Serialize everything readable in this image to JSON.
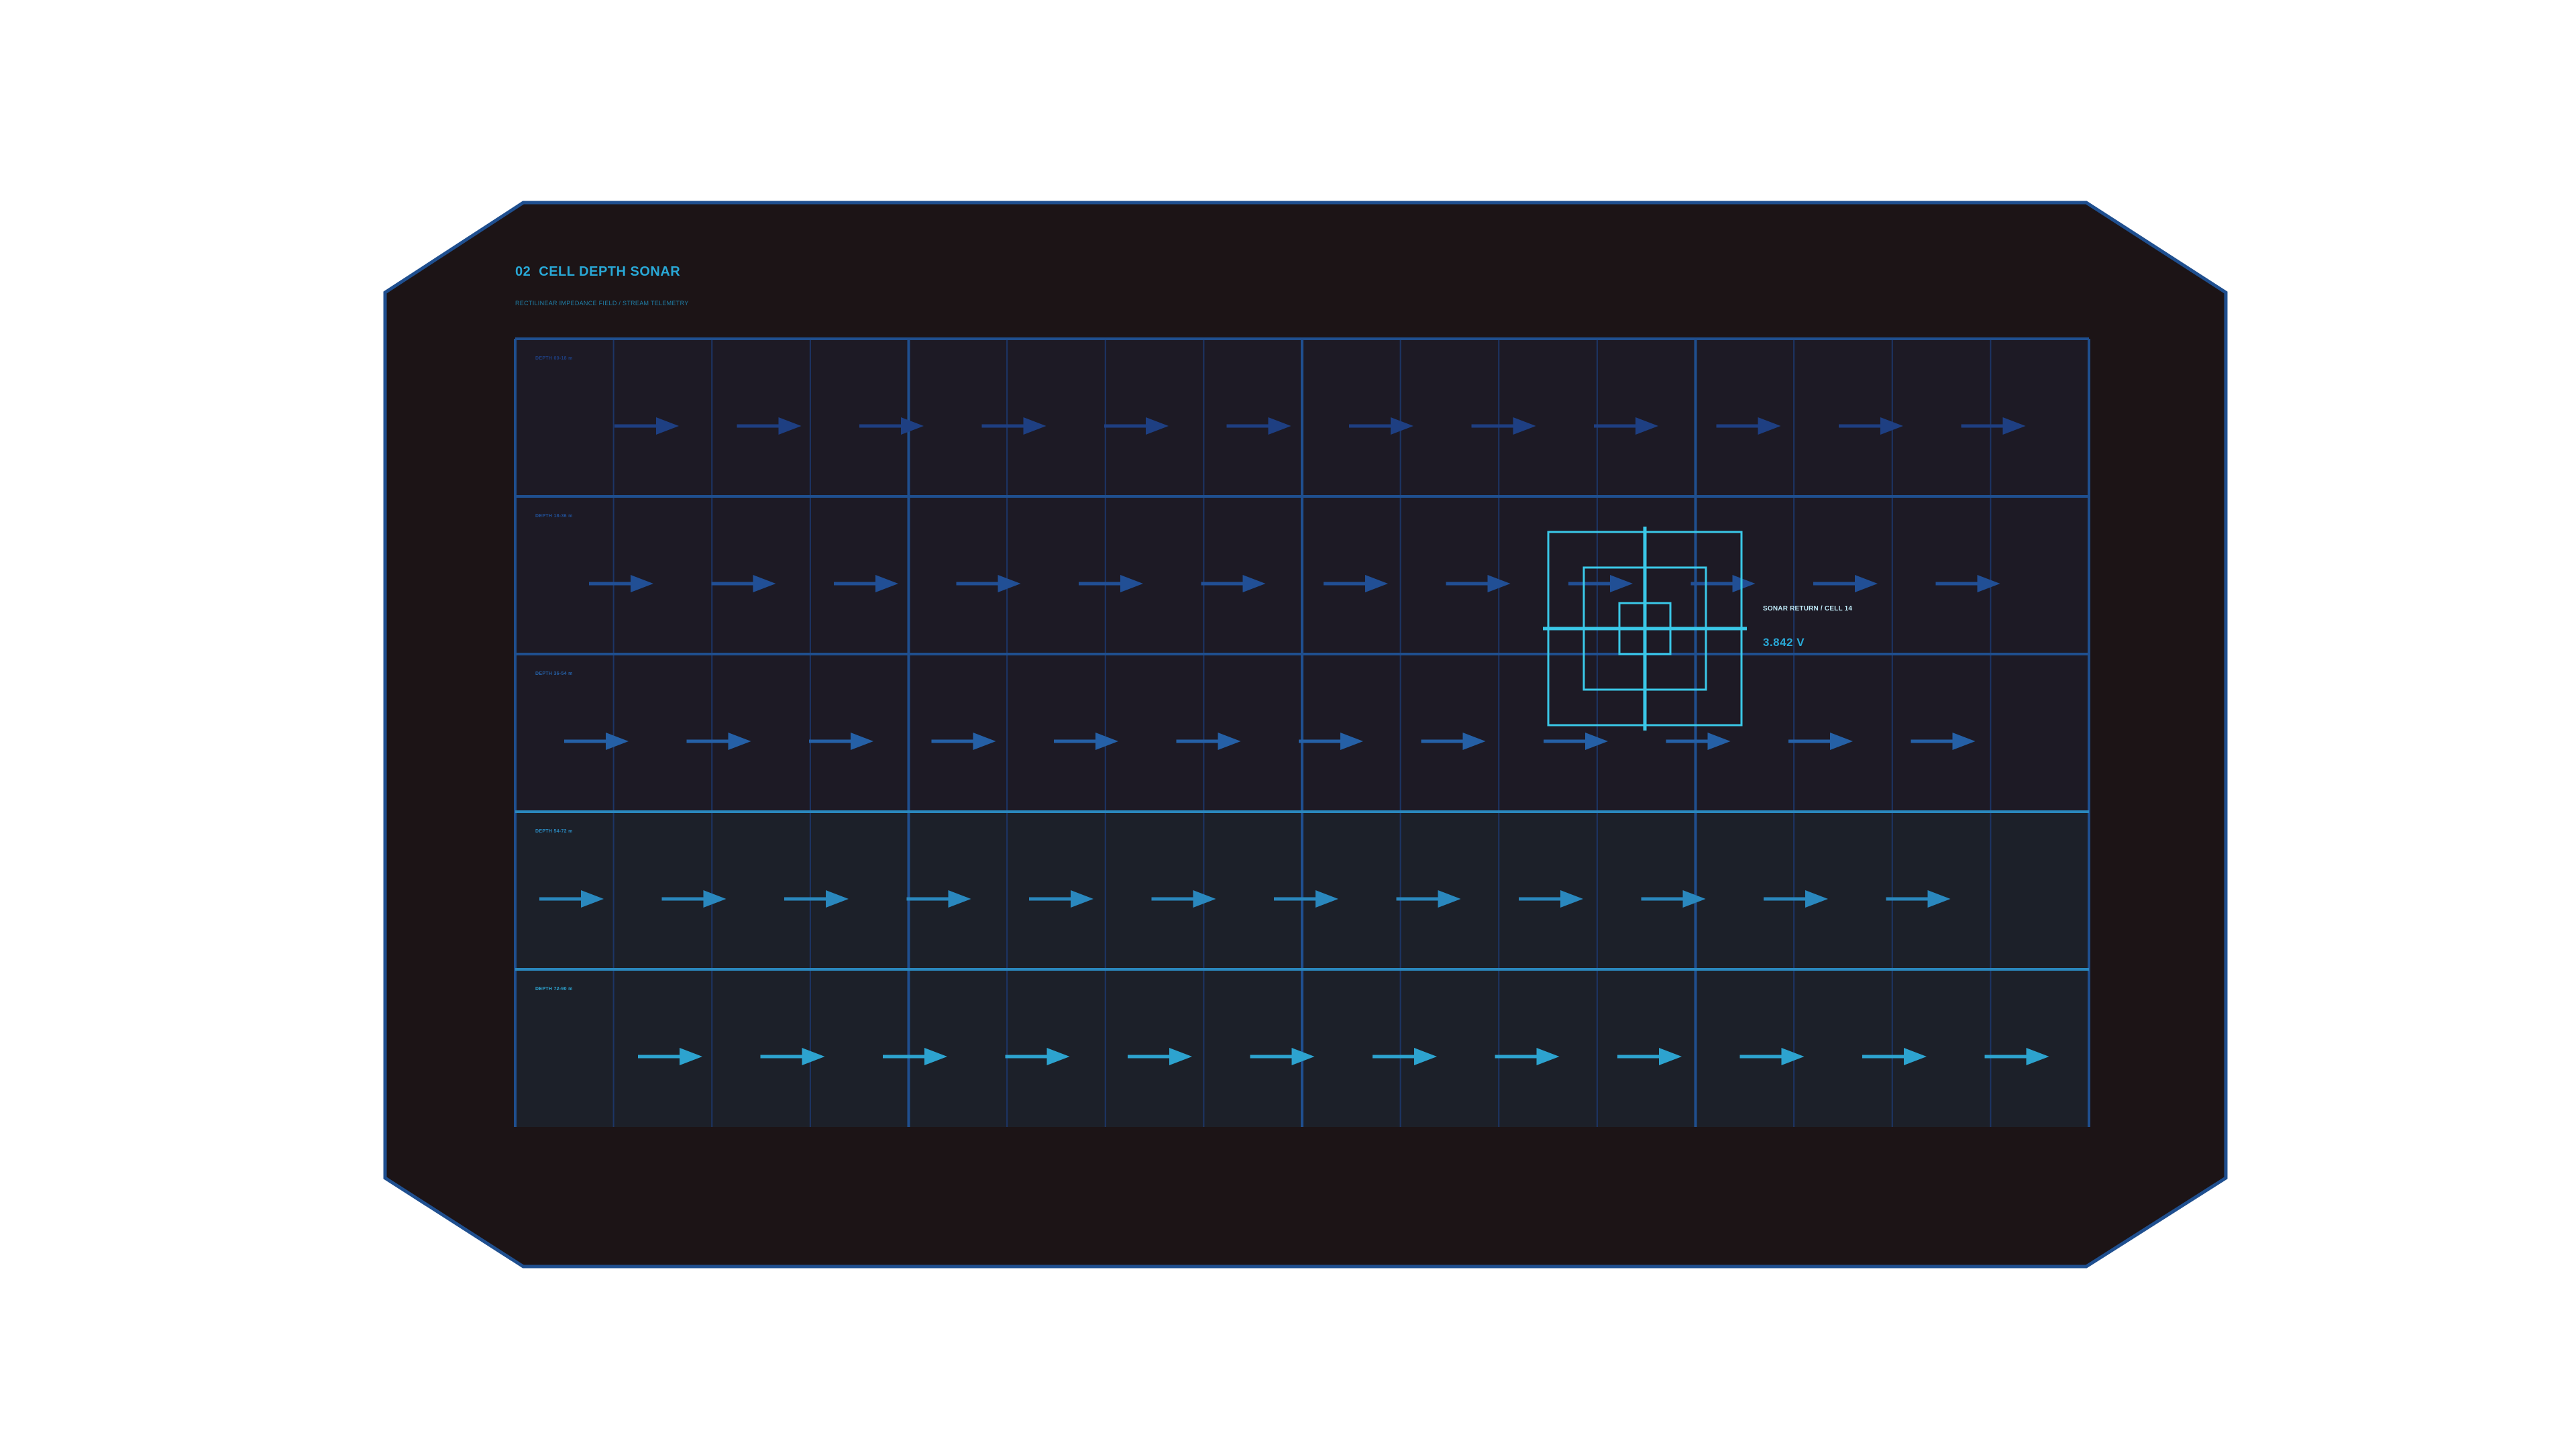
{
  "panel": {
    "index": "02",
    "title": "CELL DEPTH SONAR",
    "subtitle": "RECTILINEAR IMPEDANCE FIELD / STREAM TELEMETRY",
    "colors": {
      "frame_fill": "#1c1416",
      "frame_stroke": "#1f4f8f",
      "accent": "#29a8d6",
      "reticle": "#3ac8e8"
    }
  },
  "bands": [
    {
      "label": "DEPTH 00-18 m",
      "arrow_count": 12,
      "arrow_color": "#1e3f82",
      "label_color": "#1e3f82",
      "fill": "#1d1a25"
    },
    {
      "label": "DEPTH 18-36 m",
      "arrow_count": 12,
      "arrow_color": "#214f95",
      "label_color": "#214f95",
      "fill": "#1d1a25"
    },
    {
      "label": "DEPTH 36-54 m",
      "arrow_count": 12,
      "arrow_color": "#2560a6",
      "label_color": "#2560a6",
      "fill": "#1d1a25"
    },
    {
      "label": "DEPTH 54-72 m",
      "arrow_count": 12,
      "arrow_color": "#2a88be",
      "label_color": "#2a88be",
      "fill": "#1c2029"
    },
    {
      "label": "DEPTH 72-90 m",
      "arrow_count": 12,
      "arrow_color": "#2da3cf",
      "label_color": "#2da3cf",
      "fill": "#1c2029"
    }
  ],
  "sonar_return": {
    "label": "SONAR RETURN / CELL 14",
    "value": "3.842 V"
  },
  "icons": {
    "arrow": "flow-arrow-right-icon",
    "reticle": "crosshair-reticle-icon"
  }
}
